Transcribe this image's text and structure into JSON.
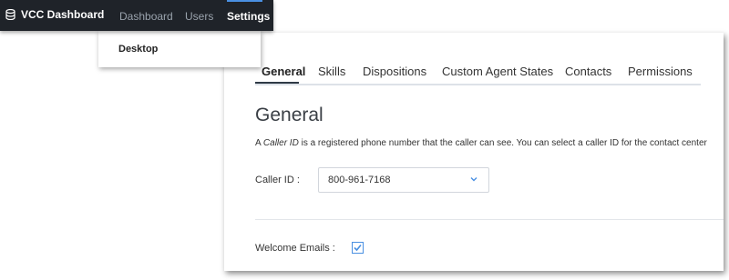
{
  "topbar": {
    "brand": "VCC Dashboard",
    "brand_icon": "database-icon",
    "nav": [
      {
        "label": "Dashboard",
        "active": false
      },
      {
        "label": "Users",
        "active": false
      },
      {
        "label": "Settings",
        "active": true
      }
    ]
  },
  "subnav": {
    "items": [
      {
        "label": "Desktop"
      }
    ]
  },
  "tabs": [
    {
      "label": "General",
      "active": true
    },
    {
      "label": "Skills"
    },
    {
      "label": "Dispositions"
    },
    {
      "label": "Custom Agent States"
    },
    {
      "label": "Contacts"
    },
    {
      "label": "Permissions"
    }
  ],
  "page": {
    "title": "General",
    "desc_prefix": "A ",
    "desc_term": "Caller ID",
    "desc_suffix": " is a registered phone number that the caller can see. You can select a caller ID for the contact center"
  },
  "caller_id": {
    "label": "Caller ID :",
    "value": "800-961-7168"
  },
  "welcome_emails": {
    "label": "Welcome Emails :",
    "checked": true
  },
  "colors": {
    "topbar_bg": "#1f2329",
    "accent": "#4a90e2"
  }
}
